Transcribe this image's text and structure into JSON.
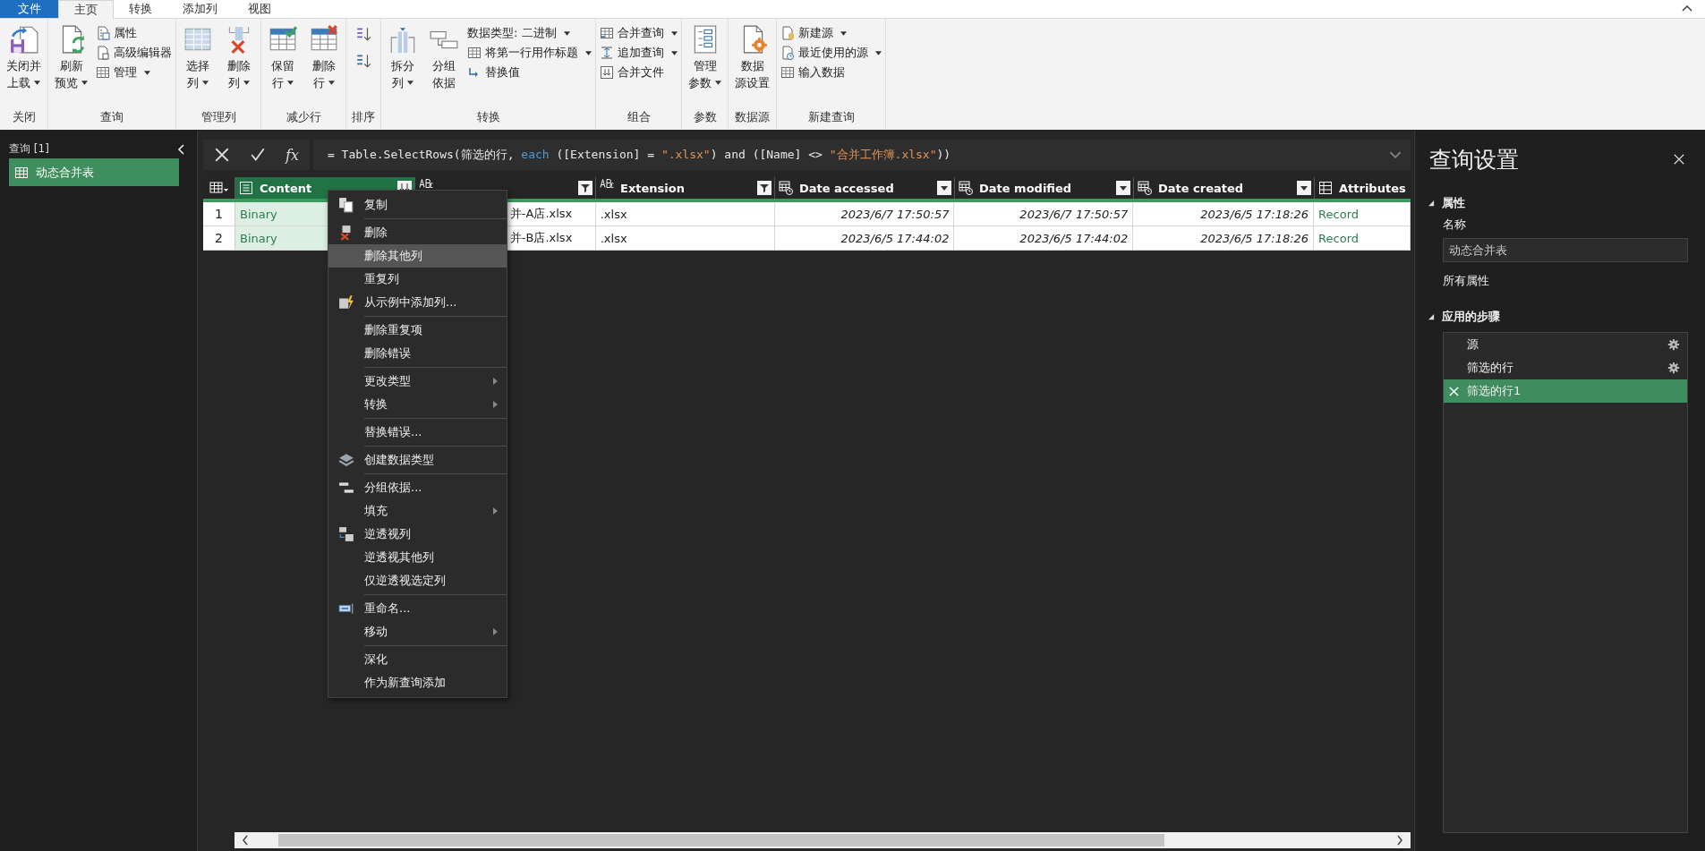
{
  "tabs": [
    {
      "label": "文件",
      "kind": "file",
      "selected": false
    },
    {
      "label": "主页",
      "kind": "tab",
      "selected": true
    },
    {
      "label": "转换",
      "kind": "tab",
      "selected": false
    },
    {
      "label": "添加列",
      "kind": "tab",
      "selected": false
    },
    {
      "label": "视图",
      "kind": "tab",
      "selected": false
    }
  ],
  "ribbon": {
    "groups": [
      {
        "label": "关闭",
        "items": [
          {
            "kind": "large",
            "lines": [
              "关闭并",
              "上载"
            ],
            "dropdown": true
          }
        ]
      },
      {
        "label": "查询",
        "items": [
          {
            "kind": "large",
            "lines": [
              "刷新",
              "预览"
            ],
            "dropdown": true
          },
          {
            "kind": "stack",
            "items": [
              {
                "kind": "small",
                "label": "属性",
                "dropdown": false
              },
              {
                "kind": "small",
                "label": "高级编辑器",
                "dropdown": false
              },
              {
                "kind": "small",
                "label": "管理",
                "dropdown": true
              }
            ]
          }
        ]
      },
      {
        "label": "管理列",
        "items": [
          {
            "kind": "large",
            "lines": [
              "选择",
              "列"
            ],
            "dropdown": true
          },
          {
            "kind": "large",
            "lines": [
              "删除",
              "列"
            ],
            "dropdown": true
          }
        ]
      },
      {
        "label": "减少行",
        "items": [
          {
            "kind": "large",
            "lines": [
              "保留",
              "行"
            ],
            "dropdown": true
          },
          {
            "kind": "large",
            "lines": [
              "删除",
              "行"
            ],
            "dropdown": true
          }
        ]
      },
      {
        "label": "排序",
        "items": [
          {
            "kind": "stack",
            "items": [
              {
                "kind": "icon"
              },
              {
                "kind": "icon"
              }
            ]
          }
        ]
      },
      {
        "label": "转换",
        "items": [
          {
            "kind": "large",
            "lines": [
              "拆分",
              "列"
            ],
            "dropdown": true
          },
          {
            "kind": "large",
            "lines": [
              "分组",
              "依据"
            ],
            "dropdown": false
          },
          {
            "kind": "stack",
            "items": [
              {
                "kind": "text",
                "label": "数据类型: 二进制",
                "dropdown": true
              },
              {
                "kind": "small",
                "label": "将第一行用作标题",
                "dropdown": true
              },
              {
                "kind": "small",
                "label": "替换值",
                "dropdown": false
              }
            ]
          }
        ]
      },
      {
        "label": "组合",
        "items": [
          {
            "kind": "stack",
            "items": [
              {
                "kind": "small",
                "label": "合并查询",
                "dropdown": true
              },
              {
                "kind": "small",
                "label": "追加查询",
                "dropdown": true
              },
              {
                "kind": "small",
                "label": "合并文件",
                "dropdown": false
              }
            ]
          }
        ]
      },
      {
        "label": "参数",
        "items": [
          {
            "kind": "large",
            "lines": [
              "管理",
              "参数"
            ],
            "dropdown": true
          }
        ]
      },
      {
        "label": "数据源",
        "items": [
          {
            "kind": "large",
            "lines": [
              "数据",
              "源设置"
            ],
            "dropdown": false
          }
        ]
      },
      {
        "label": "新建查询",
        "items": [
          {
            "kind": "stack",
            "items": [
              {
                "kind": "small",
                "label": "新建源",
                "dropdown": true
              },
              {
                "kind": "small",
                "label": "最近使用的源",
                "dropdown": true
              },
              {
                "kind": "small",
                "label": "输入数据",
                "dropdown": false
              }
            ]
          }
        ]
      }
    ]
  },
  "queries_pane": {
    "title": "查询 [1]",
    "items": [
      {
        "label": "动态合并表",
        "selected": true
      }
    ]
  },
  "formula_bar": {
    "fx": "fx",
    "segments": [
      {
        "kind": "plain",
        "text": "= Table.SelectRows(筛选的行, "
      },
      {
        "kind": "keyword",
        "text": "each"
      },
      {
        "kind": "plain",
        "text": " ([Extension] = "
      },
      {
        "kind": "string",
        "text": "\".xlsx\""
      },
      {
        "kind": "plain",
        "text": ") and ([Name] <> "
      },
      {
        "kind": "string",
        "text": "\"合并工作簿.xlsx\""
      },
      {
        "kind": "plain",
        "text": "))"
      }
    ]
  },
  "table": {
    "columns": [
      {
        "label": "Content",
        "kind": "binary",
        "selected": true
      },
      {
        "kind": "text",
        "filtered": true,
        "selected": false
      },
      {
        "label": "Extension",
        "kind": "text",
        "filtered": true,
        "selected": false
      },
      {
        "label": "Date accessed",
        "kind": "datetime",
        "filtered": false,
        "selected": false
      },
      {
        "label": "Date modified",
        "kind": "datetime",
        "filtered": false,
        "selected": false
      },
      {
        "label": "Date created",
        "kind": "datetime",
        "filtered": false,
        "selected": false
      },
      {
        "label": "Attributes",
        "kind": "record",
        "selected": false
      }
    ],
    "rows": [
      {
        "number": "1",
        "cells": [
          "Binary",
          "并-A店.xlsx",
          ".xlsx",
          "2023/6/7 17:50:57",
          "2023/6/7 17:50:57",
          "2023/6/5 17:18:26",
          "Record"
        ]
      },
      {
        "number": "2",
        "cells": [
          "Binary",
          "并-B店.xlsx",
          ".xlsx",
          "2023/6/5 17:44:02",
          "2023/6/5 17:44:02",
          "2023/6/5 17:18:26",
          "Record"
        ]
      }
    ]
  },
  "context_menu": {
    "groups": [
      [
        {
          "label": "复制",
          "submenu": false,
          "selected": false
        }
      ],
      [
        {
          "label": "删除",
          "submenu": false,
          "selected": false
        },
        {
          "label": "删除其他列",
          "submenu": false,
          "selected": true
        },
        {
          "label": "重复列",
          "submenu": false,
          "selected": false
        },
        {
          "label": "从示例中添加列...",
          "submenu": false,
          "selected": false
        }
      ],
      [
        {
          "label": "删除重复项",
          "submenu": false,
          "selected": false
        },
        {
          "label": "删除错误",
          "submenu": false,
          "selected": false
        }
      ],
      [
        {
          "label": "更改类型",
          "submenu": true,
          "selected": false
        },
        {
          "label": "转换",
          "submenu": true,
          "selected": false
        }
      ],
      [
        {
          "label": "替换错误...",
          "submenu": false,
          "selected": false
        }
      ],
      [
        {
          "label": "创建数据类型",
          "submenu": false,
          "selected": false
        }
      ],
      [
        {
          "label": "分组依据...",
          "submenu": false,
          "selected": false
        },
        {
          "label": "填充",
          "submenu": true,
          "selected": false
        },
        {
          "label": "逆透视列",
          "submenu": false,
          "selected": false
        },
        {
          "label": "逆透视其他列",
          "submenu": false,
          "selected": false
        },
        {
          "label": "仅逆透视选定列",
          "submenu": false,
          "selected": false
        }
      ],
      [
        {
          "label": "重命名...",
          "submenu": false,
          "selected": false
        },
        {
          "label": "移动",
          "submenu": true,
          "selected": false
        }
      ],
      [
        {
          "label": "深化",
          "submenu": false,
          "selected": false
        },
        {
          "label": "作为新查询添加",
          "submenu": false,
          "selected": false
        }
      ]
    ]
  },
  "query_settings": {
    "title": "查询设置",
    "properties": {
      "heading": "属性",
      "name_label": "名称",
      "name": "动态合并表",
      "all_properties": "所有属性"
    },
    "steps_heading": "应用的步骤",
    "steps": [
      {
        "label": "源",
        "settings": true,
        "selected": false
      },
      {
        "label": "筛选的行",
        "settings": true,
        "selected": false
      },
      {
        "label": "筛选的行1",
        "settings": false,
        "selected": true
      }
    ]
  }
}
